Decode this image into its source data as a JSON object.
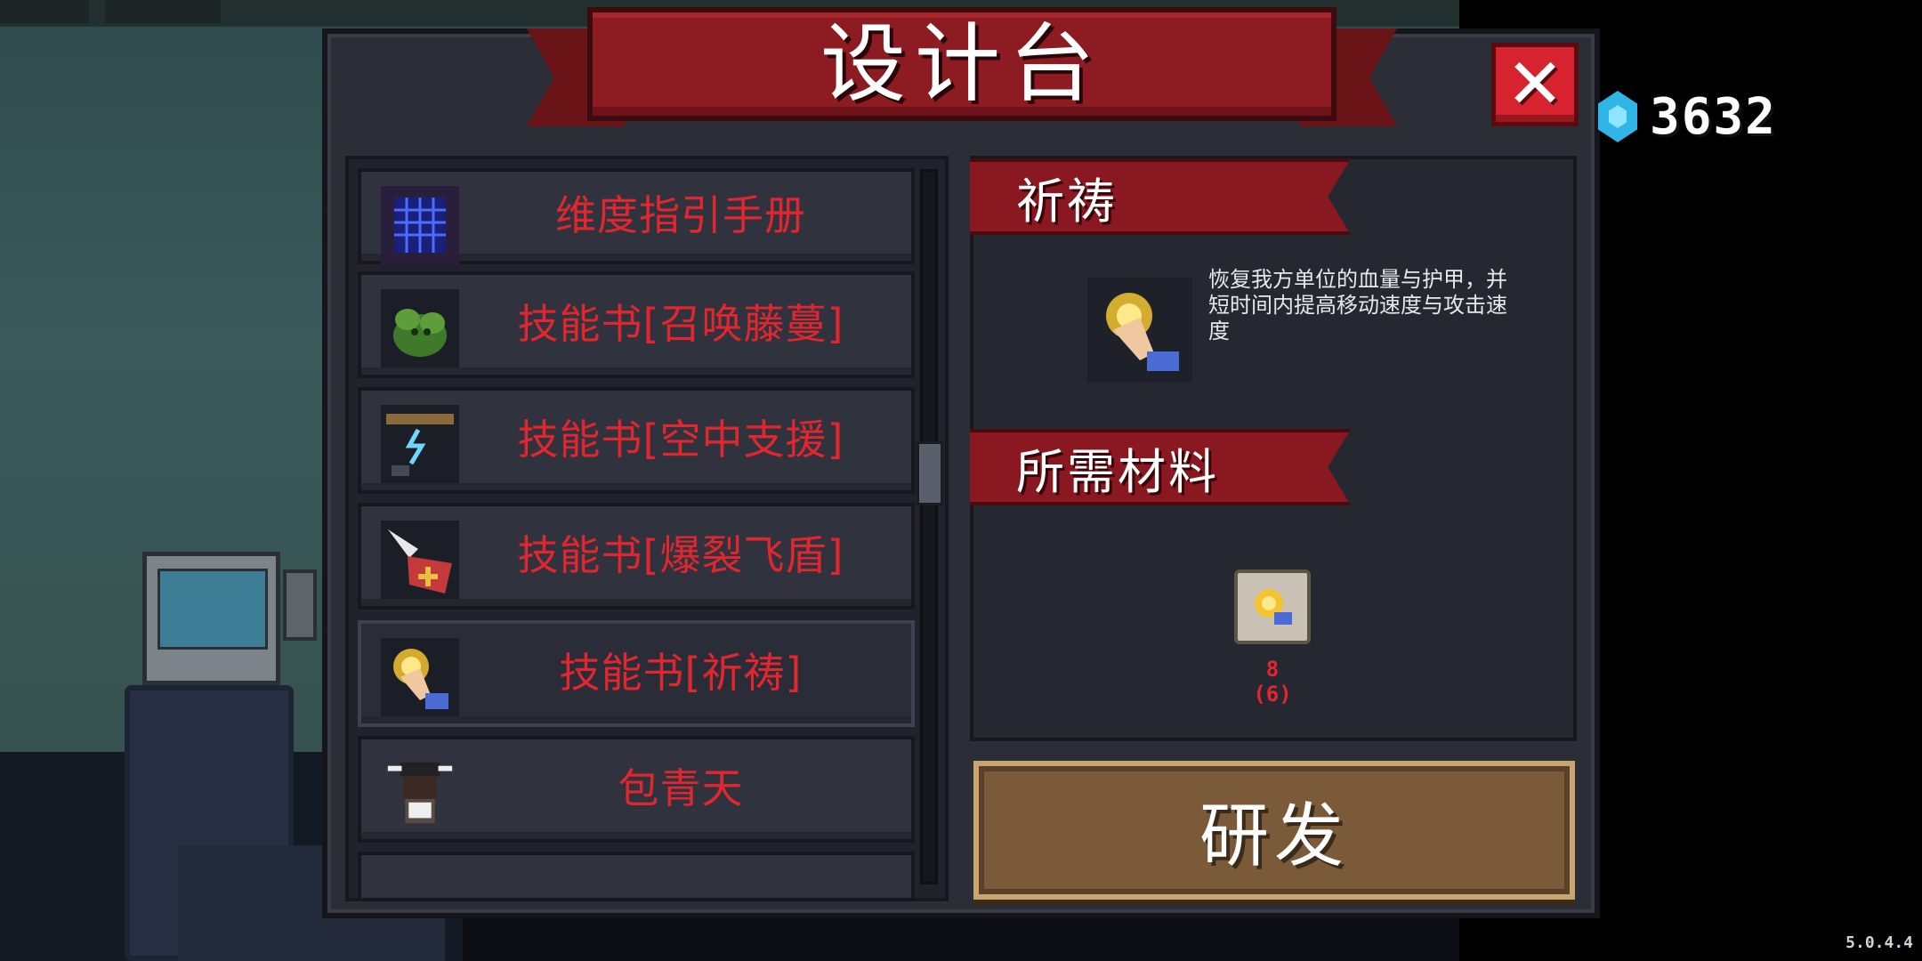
{
  "dialog": {
    "title": "设计台",
    "close_label": "✕"
  },
  "currency": {
    "icon": "blue-gem-icon",
    "amount": "3632"
  },
  "list": {
    "items": [
      {
        "label": "维度指引手册",
        "icon": "grid-manual-icon"
      },
      {
        "label": "技能书[召唤藤蔓]",
        "icon": "vine-plant-icon"
      },
      {
        "label": "技能书[空中支援]",
        "icon": "air-support-icon"
      },
      {
        "label": "技能书[爆裂飞盾]",
        "icon": "flying-shield-icon"
      },
      {
        "label": "技能书[祈祷]",
        "icon": "praying-hands-icon",
        "selected": true
      },
      {
        "label": "包青天",
        "icon": "judge-character-icon"
      },
      {
        "label": "",
        "icon": "partial-item-icon"
      }
    ]
  },
  "detail": {
    "skill_name": "祈祷",
    "description": "恢复我方单位的血量与护甲，并短时间内提高移动速度与攻击速度",
    "materials_header": "所需材料",
    "material_count": "8",
    "material_required": "(6)",
    "research_label": "研发"
  },
  "version": "5.0.4.4",
  "colors": {
    "panel_bg": "#2b2e37",
    "banner_red": "#8c1b22",
    "item_text_red": "#e0262e",
    "button_brown": "#7a5a38"
  }
}
